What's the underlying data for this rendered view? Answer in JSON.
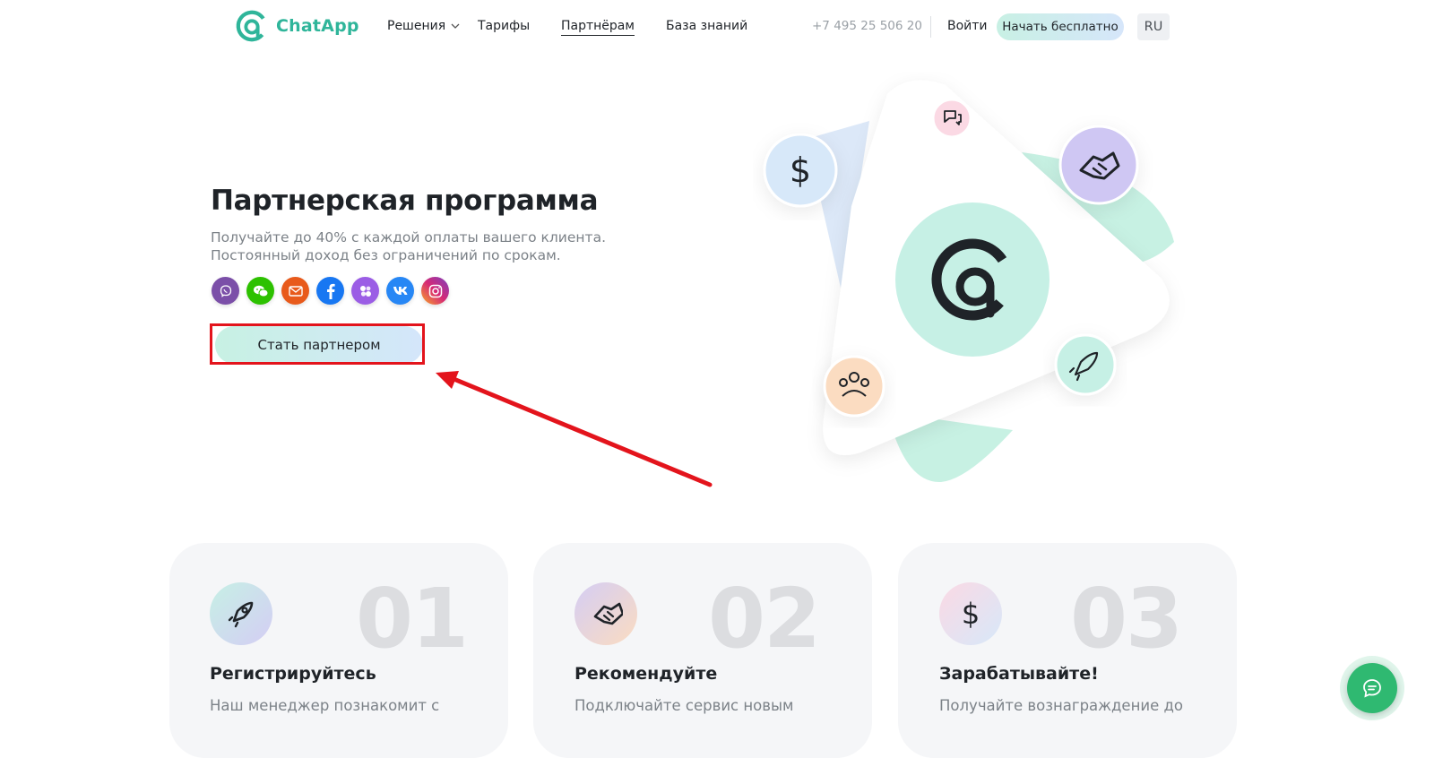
{
  "header": {
    "logo_text": "ChatApp",
    "nav": [
      {
        "label": "Решения"
      },
      {
        "label": "Тарифы"
      },
      {
        "label": "Партнёрам"
      },
      {
        "label": "База знаний"
      }
    ],
    "phone": "+7 495 25 506 20",
    "login_label": "Войти",
    "start_label": "Начать бесплатно",
    "language": "RU"
  },
  "hero": {
    "title": "Партнерская программа",
    "subtitle_line1": "Получайте до 40% с каждой оплаты вашего клиента.",
    "subtitle_line2": "Постоянный доход без ограничений по срокам.",
    "messengers": [
      {
        "name": "viber-icon",
        "color": "#7b4fa8"
      },
      {
        "name": "wechat-icon",
        "color": "#2dc100"
      },
      {
        "name": "email-icon",
        "color": "#e85a1b"
      },
      {
        "name": "facebook-icon",
        "color": "#1877f2"
      },
      {
        "name": "flock-icon",
        "color": "#9b5de5"
      },
      {
        "name": "vk-icon",
        "color": "#2787f5"
      },
      {
        "name": "instagram-icon",
        "color": "#d62976"
      }
    ],
    "cta_label": "Стать партнером"
  },
  "illustration": {
    "icons": [
      "dollar-icon",
      "chat-icon",
      "handshake-icon",
      "chatapp-logo-icon",
      "team-icon",
      "rocket-icon"
    ]
  },
  "steps": [
    {
      "number": "01",
      "title": "Регистрируйтесь",
      "text": "Наш менеджер познакомит с",
      "icon": "rocket-icon"
    },
    {
      "number": "02",
      "title": "Рекомендуйте",
      "text": "Подключайте сервис новым",
      "icon": "handshake-icon"
    },
    {
      "number": "03",
      "title": "Зарабатывайте!",
      "text": "Получайте вознаграждение до",
      "icon": "dollar-icon"
    }
  ],
  "colors": {
    "brand": "#2fb59a",
    "annotation": "#e3141c",
    "chat_widget": "#2fb971"
  }
}
